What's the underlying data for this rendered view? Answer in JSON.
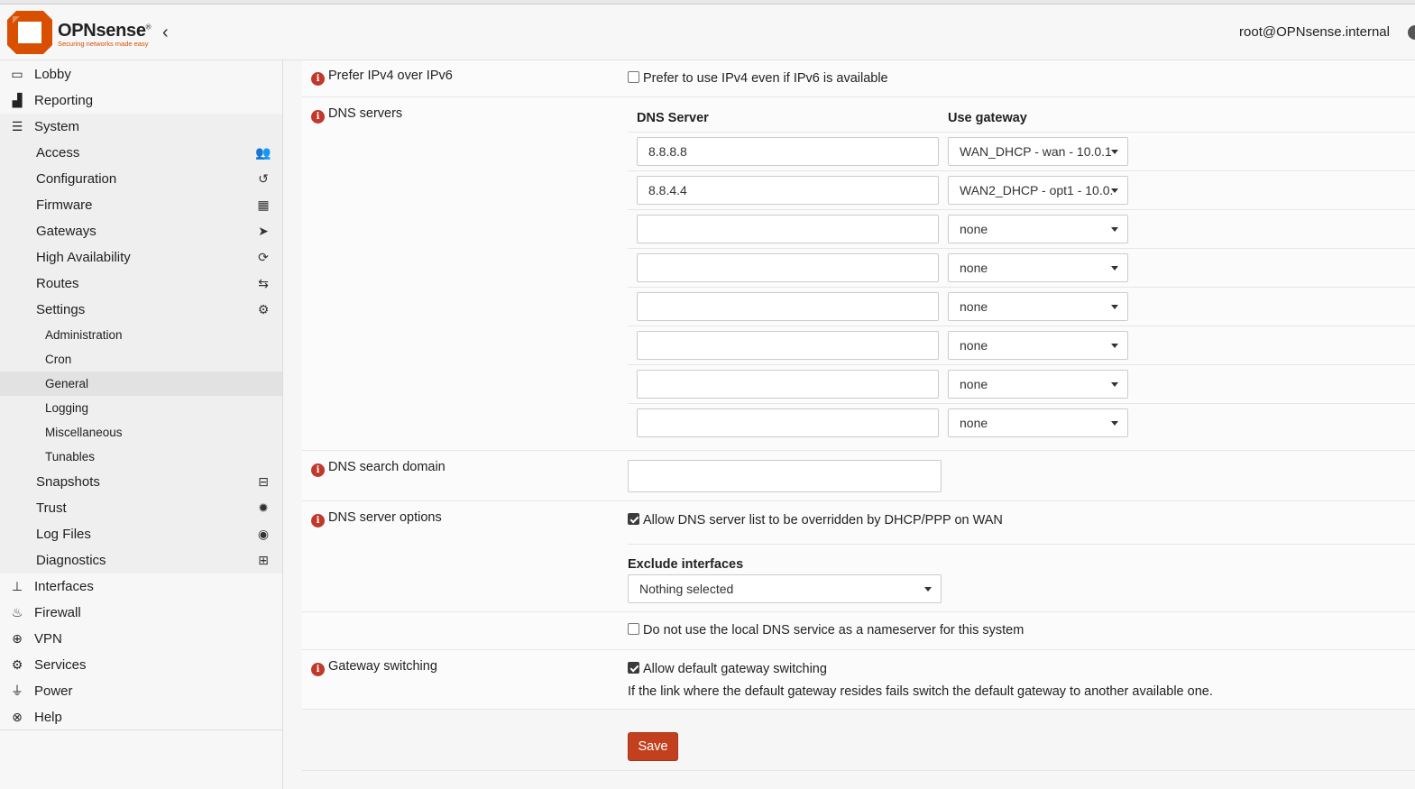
{
  "header": {
    "brand_name": "OPNsense",
    "brand_tagline": "Securing networks made easy",
    "user": "root@OPNsense.internal"
  },
  "sidebar": {
    "top_items": [
      {
        "label": "Lobby",
        "icon": "laptop-icon"
      },
      {
        "label": "Reporting",
        "icon": "area-chart-icon"
      },
      {
        "label": "System",
        "icon": "server-icon"
      }
    ],
    "system_items": [
      {
        "label": "Access",
        "icon": "users-icon"
      },
      {
        "label": "Configuration",
        "icon": "history-icon"
      },
      {
        "label": "Firmware",
        "icon": "building-icon"
      },
      {
        "label": "Gateways",
        "icon": "location-arrow-icon"
      },
      {
        "label": "High Availability",
        "icon": "refresh-icon"
      },
      {
        "label": "Routes",
        "icon": "map-signs-icon"
      },
      {
        "label": "Settings",
        "icon": "cogs-icon"
      }
    ],
    "settings_items": [
      {
        "label": "Administration"
      },
      {
        "label": "Cron"
      },
      {
        "label": "General",
        "active": true
      },
      {
        "label": "Logging"
      },
      {
        "label": "Miscellaneous"
      },
      {
        "label": "Tunables"
      }
    ],
    "system_items_after": [
      {
        "label": "Snapshots",
        "icon": "hdd-icon"
      },
      {
        "label": "Trust",
        "icon": "certificate-icon"
      },
      {
        "label": "Log Files",
        "icon": "eye-icon"
      },
      {
        "label": "Diagnostics",
        "icon": "medkit-icon"
      }
    ],
    "bottom_items": [
      {
        "label": "Interfaces",
        "icon": "sitemap-icon"
      },
      {
        "label": "Firewall",
        "icon": "fire-icon"
      },
      {
        "label": "VPN",
        "icon": "globe-icon"
      },
      {
        "label": "Services",
        "icon": "cog-icon"
      },
      {
        "label": "Power",
        "icon": "plug-icon"
      },
      {
        "label": "Help",
        "icon": "life-ring-icon"
      }
    ]
  },
  "form": {
    "prefer_ipv4": {
      "label": "Prefer IPv4 over IPv6",
      "checkbox_text": "Prefer to use IPv4 even if IPv6 is available",
      "checked": false
    },
    "dns_servers": {
      "label": "DNS servers",
      "col_server": "DNS Server",
      "col_gateway": "Use gateway",
      "rows": [
        {
          "server": "8.8.8.8",
          "gateway": "WAN_DHCP - wan - 10.0.1."
        },
        {
          "server": "8.8.4.4",
          "gateway": "WAN2_DHCP - opt1 - 10.0.:"
        },
        {
          "server": "",
          "gateway": "none"
        },
        {
          "server": "",
          "gateway": "none"
        },
        {
          "server": "",
          "gateway": "none"
        },
        {
          "server": "",
          "gateway": "none"
        },
        {
          "server": "",
          "gateway": "none"
        },
        {
          "server": "",
          "gateway": "none"
        }
      ]
    },
    "dns_search_domain": {
      "label": "DNS search domain",
      "value": ""
    },
    "dns_server_options": {
      "label": "DNS server options",
      "override_text": "Allow DNS server list to be overridden by DHCP/PPP on WAN",
      "override_checked": true,
      "exclude_label": "Exclude interfaces",
      "exclude_value": "Nothing selected",
      "no_local_text": "Do not use the local DNS service as a nameserver for this system",
      "no_local_checked": false
    },
    "gateway_switching": {
      "label": "Gateway switching",
      "checkbox_text": "Allow default gateway switching",
      "checked": true,
      "help": "If the link where the default gateway resides fails switch the default gateway to another available one."
    },
    "save_label": "Save"
  }
}
